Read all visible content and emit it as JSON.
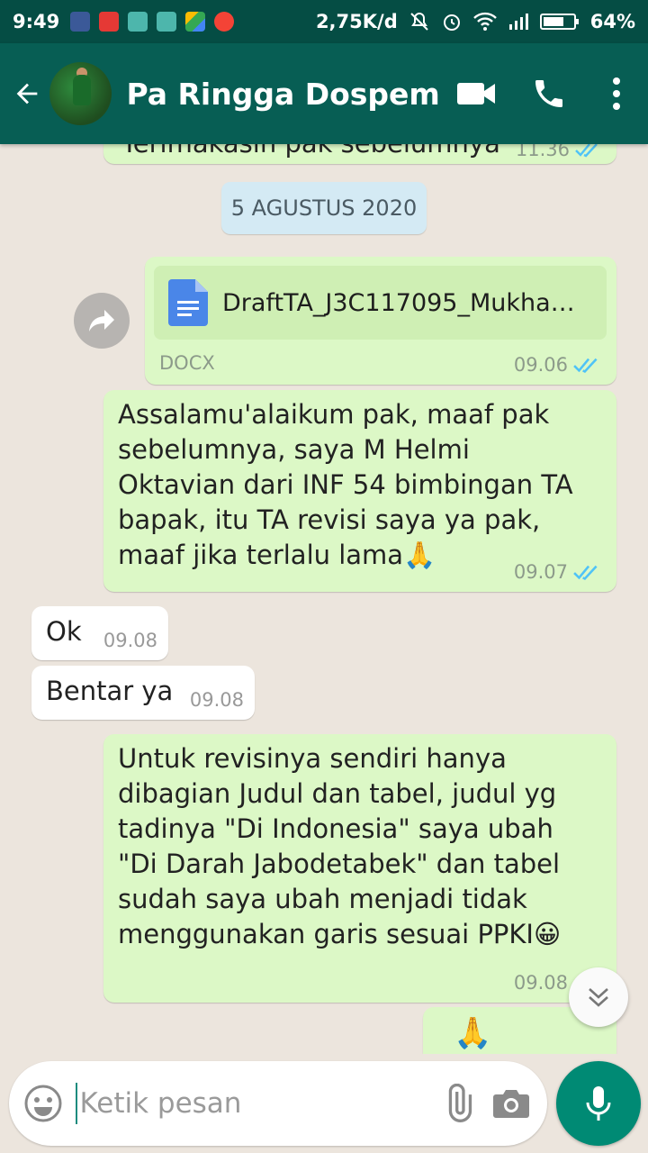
{
  "status_bar": {
    "time": "9:49",
    "network_speed": "2,75K/d",
    "battery": "64%"
  },
  "header": {
    "contact_name": "Pa Ringga Dospem",
    "icons": [
      "back-arrow-icon",
      "video-call-icon",
      "phone-icon",
      "more-vert-icon"
    ]
  },
  "chat": {
    "partial_previous": {
      "text": "Terimakasih pak sebelumnya",
      "time": "11.36"
    },
    "date_divider": "5 AGUSTUS 2020",
    "document": {
      "file_name": "DraftTA_J3C117095_Mukha…",
      "file_type": "DOCX",
      "time": "09.06"
    },
    "messages": [
      {
        "dir": "out",
        "text": "Assalamu'alaikum pak, maaf pak sebelumnya, saya M Helmi Oktavian dari INF 54 bimbingan TA bapak, itu TA revisi saya ya pak, maaf jika terlalu lama🙏",
        "time": "09.07"
      },
      {
        "dir": "in",
        "text": "Ok",
        "time": "09.08"
      },
      {
        "dir": "in",
        "text": "Bentar ya",
        "time": "09.08"
      },
      {
        "dir": "out",
        "text": "Untuk revisinya sendiri hanya dibagian Judul dan tabel, judul yg tadinya \"Di Indonesia\" saya ubah \"Di Darah Jabodetabek\" dan tabel sudah saya ubah menjadi tidak menggunakan garis sesuai PPKI😀",
        "time": "09.08"
      },
      {
        "dir": "out",
        "text": "🙏"
      }
    ]
  },
  "input": {
    "placeholder": "Ketik pesan"
  },
  "colors": {
    "header": "#075e54",
    "status_bar": "#054d44",
    "outgoing_bubble": "#dcf8c6",
    "incoming_bubble": "#ffffff",
    "read_ticks": "#4fc3f7",
    "mic_button": "#008a74"
  }
}
